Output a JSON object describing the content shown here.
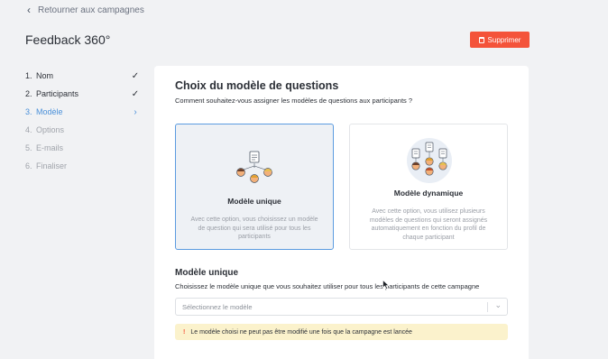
{
  "back": {
    "label": "Retourner aux campagnes"
  },
  "page": {
    "title": "Feedback 360°"
  },
  "actions": {
    "delete_label": "Supprimer"
  },
  "steps": [
    {
      "num": "1.",
      "label": "Nom",
      "state": "done"
    },
    {
      "num": "2.",
      "label": "Participants",
      "state": "done"
    },
    {
      "num": "3.",
      "label": "Modèle",
      "state": "active"
    },
    {
      "num": "4.",
      "label": "Options",
      "state": "future"
    },
    {
      "num": "5.",
      "label": "E-mails",
      "state": "future"
    },
    {
      "num": "6.",
      "label": "Finaliser",
      "state": "future"
    }
  ],
  "main": {
    "title": "Choix du modèle de questions",
    "subtitle": "Comment souhaitez-vous assigner les modèles de questions aux participants ?",
    "options": [
      {
        "name": "Modèle unique",
        "description": "Avec cette option, vous choisissez un modèle de question qui sera utilisé pour tous les participants",
        "selected": true
      },
      {
        "name": "Modèle dynamique",
        "description": "Avec cette option, vous utilisez plusieurs modèles de questions qui seront assignés automatiquement en fonction du profil de chaque participant",
        "selected": false
      }
    ],
    "section_title": "Modèle unique",
    "section_subtitle": "Choisissez le modèle unique que vous souhaitez utiliser pour tous les participants de cette campagne",
    "select_placeholder": "Sélectionnez le modèle",
    "warning_icon": "!",
    "warning": "Le modèle choisi ne peut pas être modifié une fois que la campagne est lancée"
  },
  "colors": {
    "accent": "#4a90d9",
    "danger": "#f4533a",
    "warning_bg": "#fbf2cc"
  }
}
